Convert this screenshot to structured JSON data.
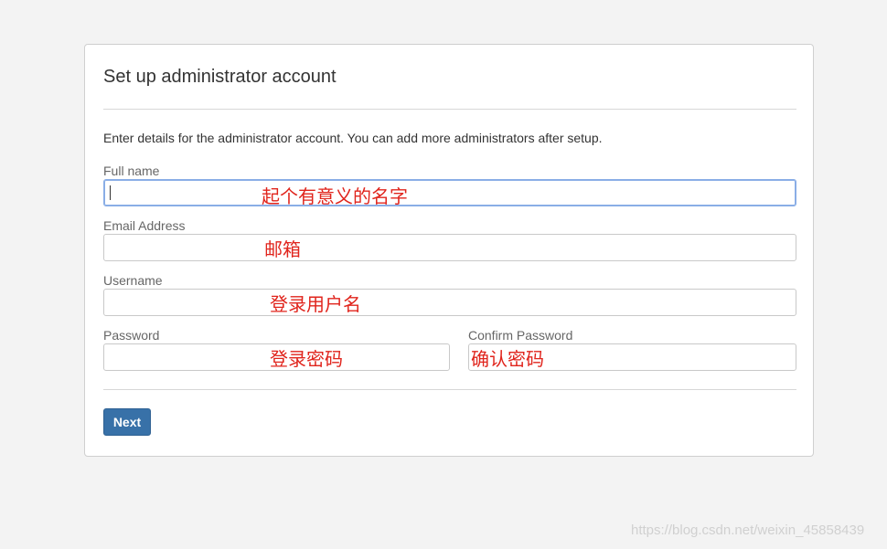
{
  "form": {
    "title": "Set up administrator account",
    "intro": "Enter details for the administrator account. You can add more administrators after setup.",
    "fields": {
      "full_name": {
        "label": "Full name",
        "value": "",
        "annotation": "起个有意义的名字"
      },
      "email": {
        "label": "Email Address",
        "value": "",
        "annotation": "邮箱"
      },
      "username": {
        "label": "Username",
        "value": "",
        "annotation": "登录用户名"
      },
      "password": {
        "label": "Password",
        "value": "",
        "annotation": "登录密码"
      },
      "confirm_password": {
        "label": "Confirm Password",
        "value": "",
        "annotation": "确认密码"
      }
    },
    "next_label": "Next"
  },
  "watermark": "https://blog.csdn.net/weixin_45858439",
  "colors": {
    "background": "#f3f3f3",
    "panel": "#ffffff",
    "button": "#3871a8",
    "annotation": "#e0241c",
    "focus_border": "#8aaee6"
  }
}
